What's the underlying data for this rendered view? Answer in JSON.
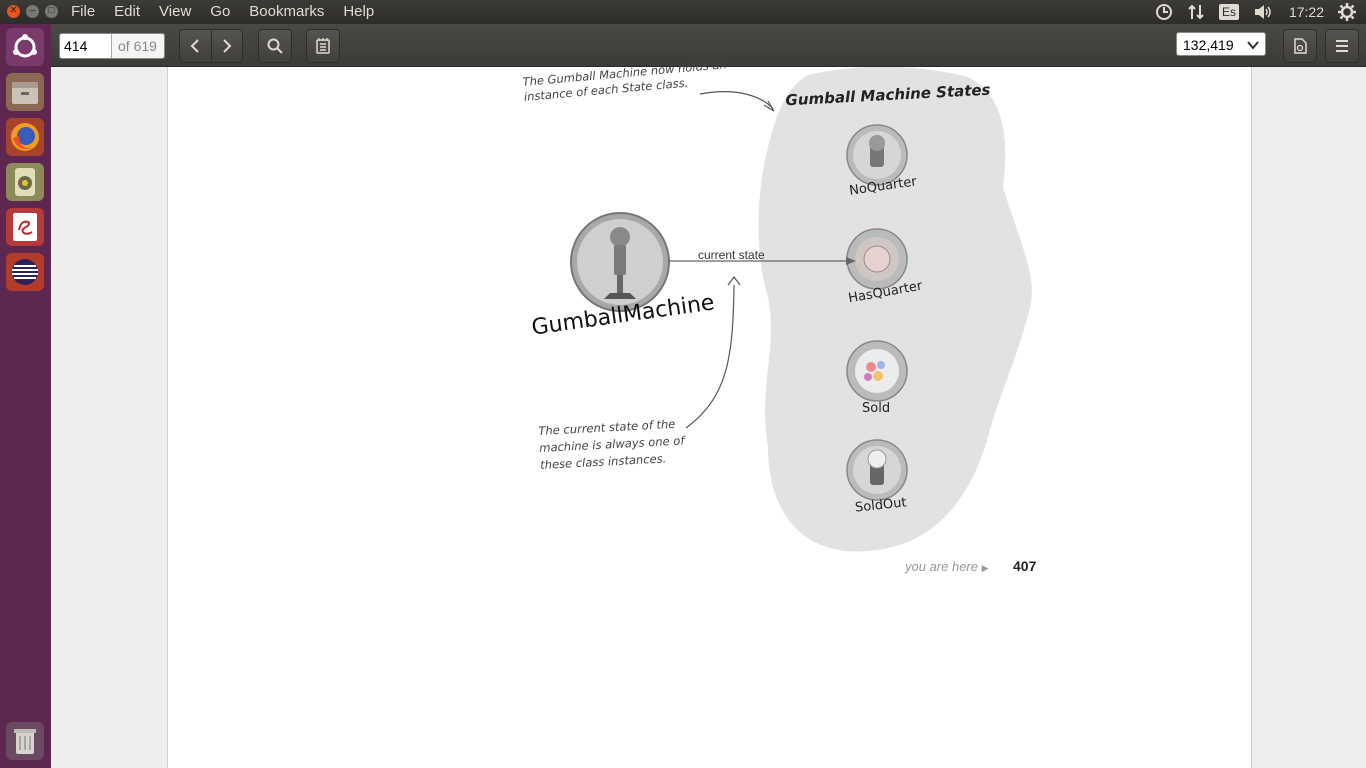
{
  "window": {
    "menus": [
      "File",
      "Edit",
      "View",
      "Go",
      "Bookmarks",
      "Help"
    ]
  },
  "tray": {
    "keyboard": "Es",
    "clock": "17:22"
  },
  "launcher": {
    "icons": [
      "ubuntu-dash-icon",
      "files-icon",
      "firefox-icon",
      "music-player-icon",
      "document-viewer-icon",
      "eclipse-icon",
      "trash-icon"
    ]
  },
  "toolbar": {
    "page_number": "414",
    "page_total": "of 619",
    "zoom": "132,419"
  },
  "diagram": {
    "states_title": "Gumball Machine States",
    "note_top": "The Gumball Machine now holds an instance of each State class.",
    "note_top_line1": "The Gumball Machine now holds an",
    "note_top_line2": "instance of each State class.",
    "machine_label": "GumballMachine",
    "arrow_label": "current state",
    "note_bottom_line1": "The current state of the",
    "note_bottom_line2": "machine is always one of",
    "note_bottom_line3": "these class instances.",
    "states": [
      "NoQuarter",
      "HasQuarter",
      "Sold",
      "SoldOut"
    ]
  },
  "footer": {
    "you_are_here": "you are here",
    "page_number": "407"
  },
  "colors": {
    "launcher": "#5e2750",
    "blob": "#e2e2e3",
    "accent": "#e9541f"
  }
}
